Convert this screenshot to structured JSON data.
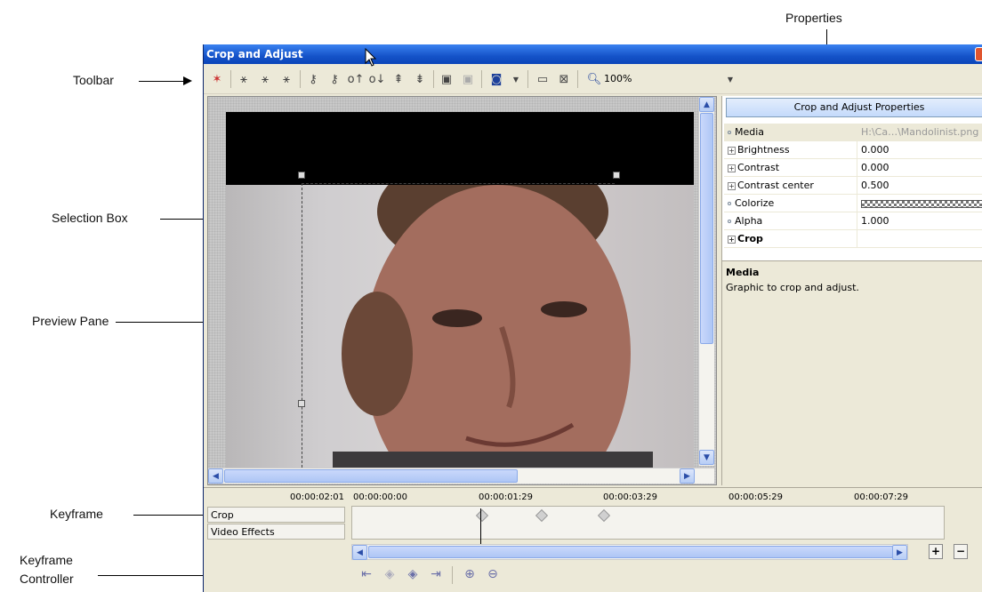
{
  "callouts": {
    "toolbar": "Toolbar",
    "selection_box": "Selection Box",
    "preview_pane": "Preview Pane",
    "keyframe": "Keyframe",
    "keyframe_controller_line1": "Keyframe",
    "keyframe_controller_line2": "Controller",
    "properties": "Properties"
  },
  "window": {
    "title": "Crop and Adjust",
    "zoom": "100%"
  },
  "properties_panel": {
    "header": "Crop and Adjust Properties",
    "rows": [
      {
        "name": "Media",
        "value": "H:\\Ca…\\Mandolinist.png"
      },
      {
        "name": "Brightness",
        "value": "0.000"
      },
      {
        "name": "Contrast",
        "value": "0.000"
      },
      {
        "name": "Contrast center",
        "value": "0.500"
      },
      {
        "name": "Colorize",
        "value": ""
      },
      {
        "name": "Alpha",
        "value": "1.000"
      },
      {
        "name": "Crop",
        "value": ""
      }
    ],
    "description_title": "Media",
    "description_text": "Graphic to crop and adjust."
  },
  "timeline": {
    "current_time": "00:00:02:01",
    "ticks": [
      "00:00:00:00",
      "00:00:01:29",
      "00:00:03:29",
      "00:00:05:29",
      "00:00:07:29"
    ],
    "tracks": [
      "Crop",
      "Video Effects"
    ]
  }
}
